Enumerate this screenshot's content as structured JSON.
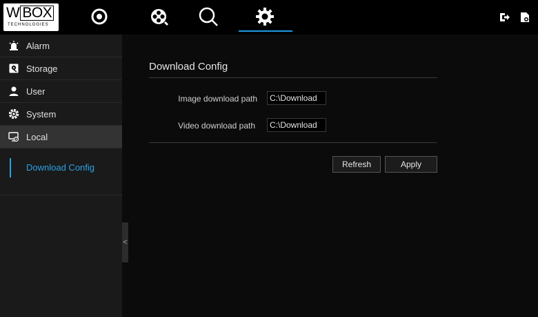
{
  "logo": {
    "brand_w": "W",
    "brand_box": "BOX",
    "subtitle": "TECHNOLOGIES"
  },
  "nav": {
    "icons": [
      "live-view-icon",
      "playback-icon",
      "search-icon",
      "settings-gear-icon"
    ],
    "active": "settings-gear-icon",
    "accent_color": "#1e9be3"
  },
  "top_actions": [
    "logout-icon",
    "file-icon"
  ],
  "sidebar": {
    "items": [
      {
        "label": "Alarm",
        "icon": "alarm-icon"
      },
      {
        "label": "Storage",
        "icon": "storage-icon"
      },
      {
        "label": "User",
        "icon": "user-icon"
      },
      {
        "label": "System",
        "icon": "system-gear-icon"
      },
      {
        "label": "Local",
        "icon": "local-monitor-icon",
        "active": true
      }
    ],
    "sub_items": [
      {
        "label": "Download Config",
        "active": true
      }
    ],
    "collapse_label": "<"
  },
  "main": {
    "title": "Download Config",
    "fields": [
      {
        "label": "Image download path",
        "value": "C:\\Download"
      },
      {
        "label": "Video download path",
        "value": "C:\\Download"
      }
    ],
    "buttons": {
      "refresh": "Refresh",
      "apply": "Apply"
    }
  }
}
